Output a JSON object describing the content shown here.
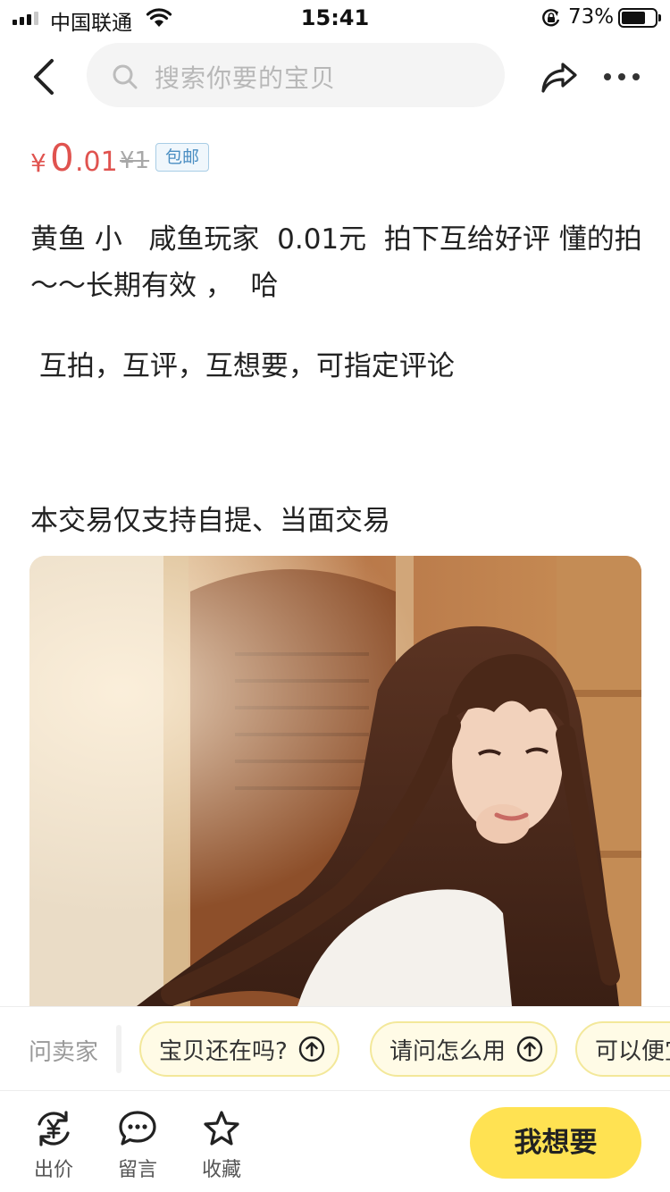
{
  "status_bar": {
    "carrier": "中国联通",
    "time": "15:41",
    "battery_percent": "73%",
    "battery_level": 0.73
  },
  "nav": {
    "search_placeholder": "搜索你要的宝贝",
    "icons": [
      "back-icon",
      "search-icon",
      "share-icon",
      "more-icon"
    ]
  },
  "price": {
    "symbol": "¥",
    "integer": "0",
    "decimal": ".01",
    "original": "¥1",
    "free_shipping": "包邮"
  },
  "description": {
    "line1": "黄鱼 小   咸鱼玩家  0.01元  拍下互给好评 懂的拍～～长期有效 ，  哈",
    "line2": " 互拍，互评，互想要，可指定评论",
    "line3": "本交易仅支持自提、当面交易"
  },
  "quick_questions": {
    "label": "问卖家",
    "items": [
      "宝贝还在吗?",
      "请问怎么用",
      "可以便宜"
    ]
  },
  "tab_bar": {
    "bid": "出价",
    "comment": "留言",
    "favorite": "收藏",
    "want": "我想要"
  },
  "colors": {
    "price_red": "#e0534f",
    "accent_yellow": "#ffe252",
    "chip_bg": "#fffbe6",
    "free_ship_blue": "#4a8ec2"
  }
}
